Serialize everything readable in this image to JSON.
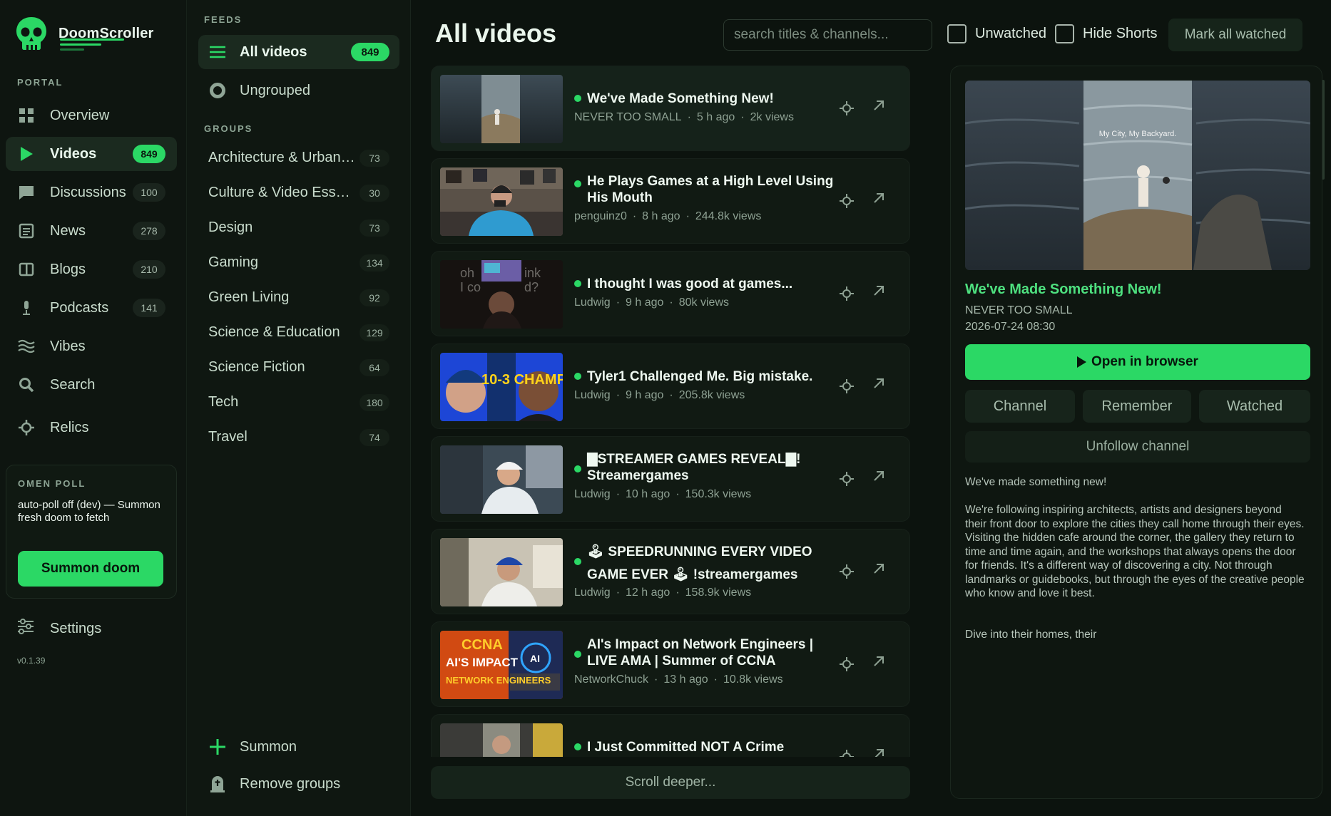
{
  "app": {
    "name": "DoomScroller",
    "version": "v0.1.39"
  },
  "nav": {
    "section_label": "PORTAL",
    "items": [
      {
        "label": "Overview",
        "icon": "grid-icon",
        "count": null,
        "active": false
      },
      {
        "label": "Videos",
        "icon": "play-icon",
        "count": "849",
        "active": true
      },
      {
        "label": "Discussions",
        "icon": "chat-icon",
        "count": "100",
        "active": false
      },
      {
        "label": "News",
        "icon": "newspaper-icon",
        "count": "278",
        "active": false
      },
      {
        "label": "Blogs",
        "icon": "book-icon",
        "count": "210",
        "active": false
      },
      {
        "label": "Podcasts",
        "icon": "microphone-icon",
        "count": "141",
        "active": false
      },
      {
        "label": "Vibes",
        "icon": "waves-icon",
        "count": null,
        "active": false
      },
      {
        "label": "Search",
        "icon": "search-icon",
        "count": null,
        "active": false
      },
      {
        "label": "Relics",
        "icon": "crosshair-icon",
        "count": null,
        "active": false
      }
    ],
    "poll": {
      "title": "OMEN POLL",
      "description": "auto-poll off (dev) — Summon fresh doom to fetch",
      "button": "Summon doom"
    },
    "settings": "Settings"
  },
  "feeds": {
    "section_label": "FEEDS",
    "all_videos": {
      "label": "All videos",
      "count": "849"
    },
    "ungrouped": {
      "label": "Ungrouped"
    },
    "groups_label": "GROUPS",
    "groups": [
      {
        "label": "Architecture & Urbani...",
        "count": "73"
      },
      {
        "label": "Culture & Video Essays",
        "count": "30"
      },
      {
        "label": "Design",
        "count": "73"
      },
      {
        "label": "Gaming",
        "count": "134"
      },
      {
        "label": "Green Living",
        "count": "92"
      },
      {
        "label": "Science & Education",
        "count": "129"
      },
      {
        "label": "Science Fiction",
        "count": "64"
      },
      {
        "label": "Tech",
        "count": "180"
      },
      {
        "label": "Travel",
        "count": "74"
      }
    ],
    "summon": "Summon",
    "remove_groups": "Remove groups"
  },
  "main": {
    "title": "All videos",
    "search_placeholder": "search titles & channels...",
    "unwatched_label": "Unwatched",
    "hide_shorts_label": "Hide Shorts",
    "mark_all_label": "Mark all watched",
    "scroll_deeper": "Scroll deeper...",
    "videos": [
      {
        "title": "We've Made Something New!",
        "channel": "NEVER TOO SMALL",
        "age": "5 h ago",
        "views": "2k views"
      },
      {
        "title": "He Plays Games at a High Level Using His Mouth",
        "channel": "penguinz0",
        "age": "8 h ago",
        "views": "244.8k views"
      },
      {
        "title": "I thought I was good at games...",
        "channel": "Ludwig",
        "age": "9 h ago",
        "views": "80k views"
      },
      {
        "title": "Tyler1 Challenged Me. Big mistake.",
        "channel": "Ludwig",
        "age": "9 h ago",
        "views": "205.8k views"
      },
      {
        "title": "▇STREAMER GAMES REVEAL▇! Streamergames",
        "channel": "Ludwig",
        "age": "10 h ago",
        "views": "150.3k views"
      },
      {
        "title": "🕹 SPEEDRUNNING EVERY VIDEO GAME EVER 🕹 !streamergames",
        "channel": "Ludwig",
        "age": "12 h ago",
        "views": "158.9k views"
      },
      {
        "title": "AI's Impact on Network Engineers | LIVE AMA | Summer of CCNA",
        "channel": "NetworkChuck",
        "age": "13 h ago",
        "views": "10.8k views"
      },
      {
        "title": "I Just Committed NOT A Crime",
        "channel": "",
        "age": "",
        "views": ""
      }
    ],
    "thumb_texts": {
      "hero_caption": "My City, My Backyard.",
      "thumb3_a": "oh",
      "thumb3_b": "ink",
      "thumb3_c": "I co",
      "thumb3_d": "d?",
      "thumb4": "10-3 CHAMP",
      "thumb7_a": "CCNA",
      "thumb7_b": "AI'S IMPACT",
      "thumb7_c": "NETWORK ENGINEERS",
      "thumb7_d": "AI"
    }
  },
  "detail": {
    "title": "We've Made Something New!",
    "channel": "NEVER TOO SMALL",
    "date": "2026-07-24 08:30",
    "open_button": "Open in browser",
    "channel_button": "Channel",
    "remember_button": "Remember",
    "watched_button": "Watched",
    "unfollow_button": "Unfollow channel",
    "desc1": "We've made something new!",
    "desc2": "We're following inspiring architects, artists and designers beyond their front door to explore the cities they call home through their eyes. Visiting the hidden cafe around the corner, the gallery they return to time and time again, and the workshops that always opens the door for friends. It's a different way of discovering a city. Not through landmarks or guidebooks, but through the eyes of the creative people who know and love it best.",
    "desc3": "Dive into their homes, their"
  },
  "colors": {
    "accent": "#2bd865",
    "background": "#0b120d",
    "panel": "#111a13"
  }
}
